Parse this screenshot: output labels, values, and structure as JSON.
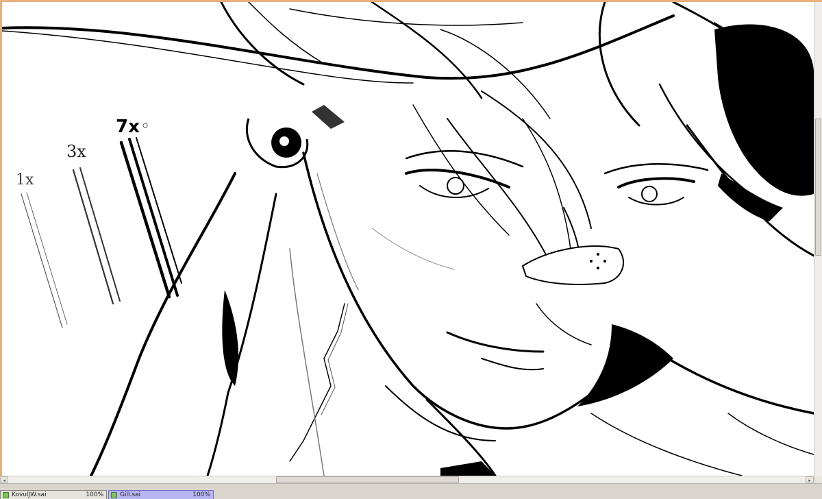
{
  "canvas": {
    "annotations": [
      "1x",
      "3x",
      "7x"
    ]
  },
  "tabs": [
    {
      "name": "KovulJW.sai",
      "zoom": "100%",
      "active": false
    },
    {
      "name": "Gill.sai",
      "zoom": "100%",
      "active": true
    }
  ],
  "scrollbars": {
    "horizontal_arrow_left": "◂",
    "horizontal_arrow_right": "▸"
  },
  "colors": {
    "window_accent": "#e8b07a",
    "active_tab": "#b9b5f2",
    "ink": "#000000",
    "sketch": "#9a9a9a"
  }
}
